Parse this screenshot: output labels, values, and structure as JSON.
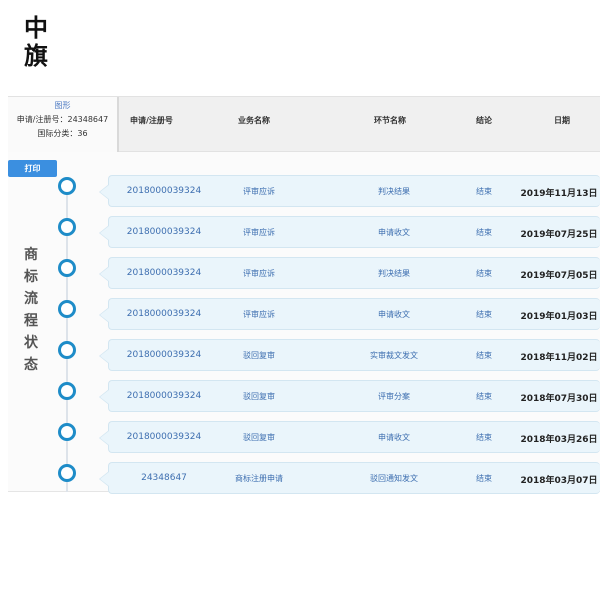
{
  "logo": {
    "line1": "中",
    "line2": "旗"
  },
  "info": {
    "mark_label": "图形",
    "reg_no_text": "申请/注册号：24348647",
    "intl_class_text": "国际分类：36"
  },
  "table_header": {
    "reg_no": "申请/注册号",
    "business": "业务名称",
    "step": "环节名称",
    "result": "结论",
    "date": "日期"
  },
  "print_label": "打印",
  "side_title": [
    "商",
    "标",
    "流",
    "程",
    "状",
    "态"
  ],
  "rows": [
    {
      "reg_no": "2018000039324",
      "business": "评审应诉",
      "step": "判决结果",
      "result": "结束",
      "date": "2019年11月13日"
    },
    {
      "reg_no": "2018000039324",
      "business": "评审应诉",
      "step": "申请收文",
      "result": "结束",
      "date": "2019年07月25日"
    },
    {
      "reg_no": "2018000039324",
      "business": "评审应诉",
      "step": "判决结果",
      "result": "结束",
      "date": "2019年07月05日"
    },
    {
      "reg_no": "2018000039324",
      "business": "评审应诉",
      "step": "申请收文",
      "result": "结束",
      "date": "2019年01月03日"
    },
    {
      "reg_no": "2018000039324",
      "business": "驳回复审",
      "step": "实审裁文发文",
      "result": "结束",
      "date": "2018年11月02日"
    },
    {
      "reg_no": "2018000039324",
      "business": "驳回复审",
      "step": "评审分案",
      "result": "结束",
      "date": "2018年07月30日"
    },
    {
      "reg_no": "2018000039324",
      "business": "驳回复审",
      "step": "申请收文",
      "result": "结束",
      "date": "2018年03月26日"
    },
    {
      "reg_no": "24348647",
      "business": "商标注册申请",
      "step": "驳回通知发文",
      "result": "结束",
      "date": "2018年03月07日"
    }
  ],
  "colors": {
    "accent": "#3b8fe0",
    "circle": "#1e8cc8",
    "row_bg": "#eaf5fb",
    "link": "#3e6fb0"
  }
}
